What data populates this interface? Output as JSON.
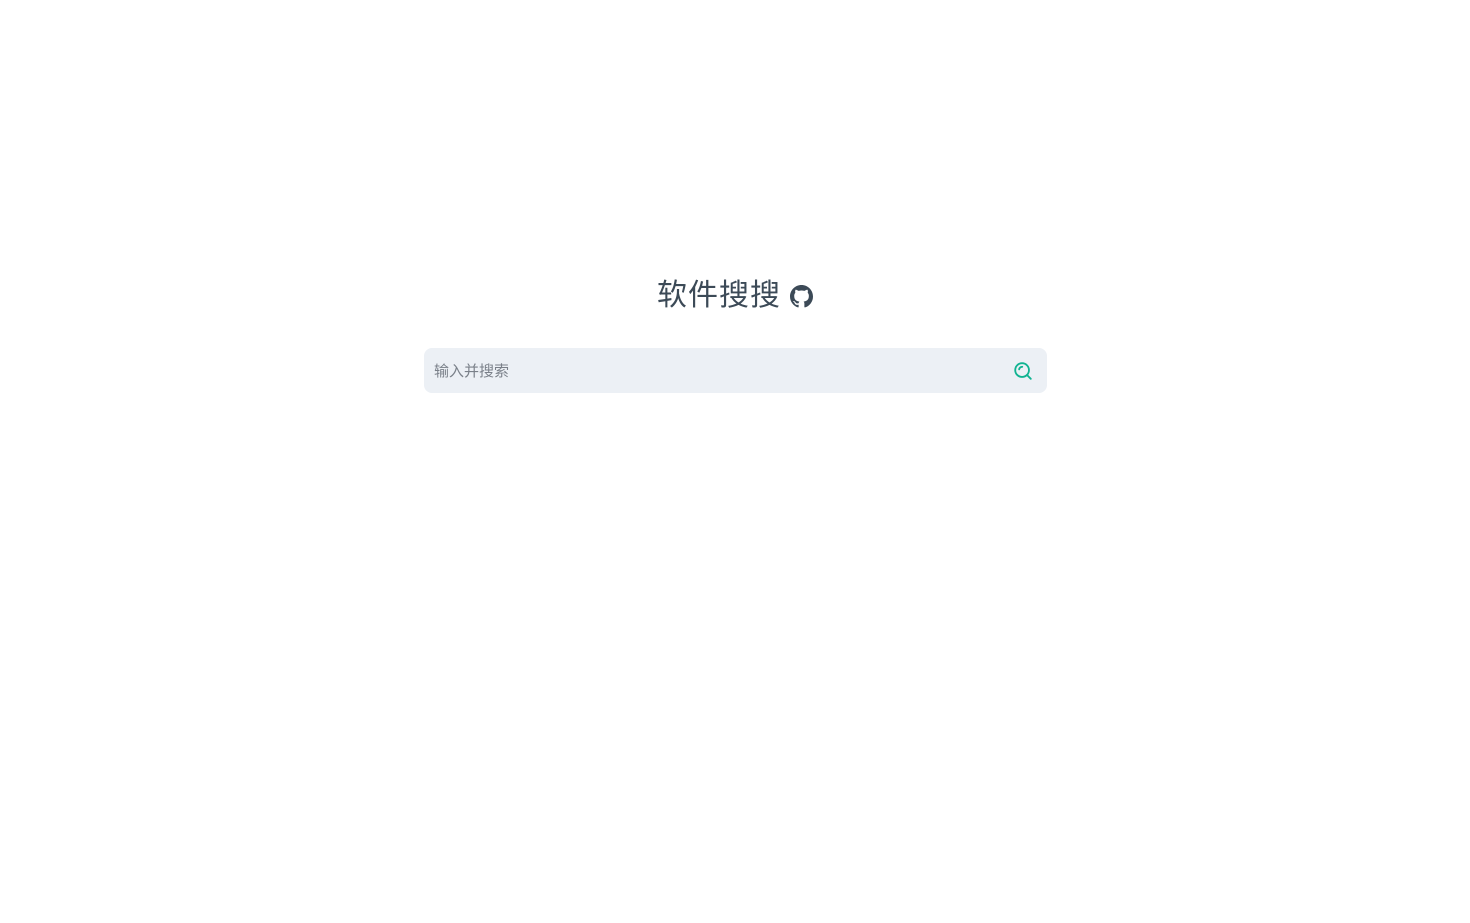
{
  "header": {
    "title": "软件搜搜",
    "github_icon": "github-icon"
  },
  "search": {
    "placeholder": "输入并搜索",
    "value": "",
    "button_icon": "search-icon"
  },
  "colors": {
    "title": "#3c4a57",
    "search_background": "#ecf0f5",
    "accent": "#10b391"
  }
}
